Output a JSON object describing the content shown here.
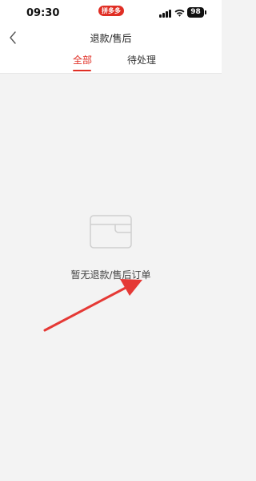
{
  "status_bar": {
    "time": "09:30",
    "app_badge": "拼多多",
    "battery": "98"
  },
  "nav": {
    "title": "退款/售后",
    "back_icon": "chevron-left-icon"
  },
  "tabs": [
    {
      "label": "全部",
      "active": true
    },
    {
      "label": "待处理",
      "active": false
    }
  ],
  "empty_state": {
    "icon": "empty-card-icon",
    "message": "暂无退款/售后订单"
  },
  "annotation": {
    "icon": "red-arrow",
    "color": "#e53935"
  },
  "colors": {
    "accent": "#e02e24",
    "background": "#f3f3f3"
  }
}
